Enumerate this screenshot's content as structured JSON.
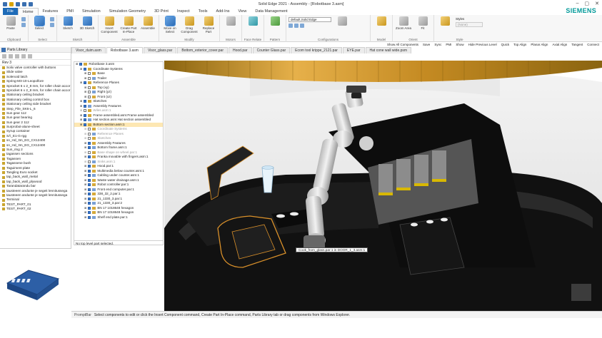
{
  "app": {
    "title": "Solid Edge 2021 - Assembly - [Robotbase 3.asm]",
    "brand": "SIEMENS",
    "window_controls": [
      "–",
      "▢",
      "✕"
    ]
  },
  "menu": {
    "file": "File",
    "tabs": [
      "Home",
      "Features",
      "PMI",
      "Simulation",
      "Simulation Geometry",
      "3D Print",
      "Inspect",
      "Tools",
      "Add-Ins",
      "View",
      "Data Management"
    ],
    "active": "Home"
  },
  "ribbon": {
    "groups": [
      {
        "label": "Clipboard",
        "buttons": [
          "Paste"
        ],
        "small": [
          "Cut",
          "Copy"
        ]
      },
      {
        "label": "Select",
        "buttons": [
          "Select"
        ],
        "small": [
          "",
          ""
        ]
      },
      {
        "label": "Sketch",
        "buttons": [
          "Sketch",
          "3D Sketch"
        ]
      },
      {
        "label": "Assemble",
        "buttons": [
          "Insert Component",
          "Create Part In-Place",
          "Assemble"
        ]
      },
      {
        "label": "Modify",
        "buttons": [
          "Move on Select",
          "Drag Component",
          "Replace Part"
        ]
      },
      {
        "label": "Motors",
        "buttons": [
          ""
        ]
      },
      {
        "label": "Face Relate",
        "buttons": [
          ""
        ]
      },
      {
        "label": "Pattern",
        "buttons": [
          ""
        ]
      },
      {
        "label": "Configurations",
        "select": "default,Solid Edge",
        "buttons": [
          ""
        ]
      },
      {
        "label": "Model",
        "buttons": [
          ""
        ]
      },
      {
        "label": "Orient",
        "buttons": [
          "Zoom Area",
          "Fit"
        ]
      },
      {
        "label": "Style",
        "buttons": [
          ""
        ],
        "select_label": "Styles",
        "select_value": "(None)"
      }
    ]
  },
  "command_bar": {
    "items": [
      "Show All Components",
      "Save",
      "Sync",
      "PMI",
      "Show",
      "Hide Previous Level",
      "Quick",
      "Top Align",
      "Planar Align",
      "Axial Align",
      "Tangent",
      "Connect"
    ]
  },
  "doc_tabs": [
    "Visor_duim.asm",
    "Robotbase 3.asm",
    "Visor_glass.par",
    "Bottom_exterior_cover.par",
    "Hood.par",
    "Counter Glass.par",
    "Ecom tool krippe_2121.par",
    "EYE.par",
    "Hat cone wall wide.psm"
  ],
  "doc_tab_active": "Robotbase 3.asm",
  "parts_library": {
    "title": "Parts Library",
    "folder": "Rev 3",
    "items": [
      "Solix valve controller with buttons",
      "Slide valve",
      "Solenoid latch",
      "Spring-M3-10-Leopolfore",
      "Sprocket 6 x 2_8 mm, for roller chain accor",
      "Sprocket 6 x 2_8 mm, for roller chain accor",
      "Stationary ceiling bracket",
      "Stationary ceiling control box",
      "Stationary ceiling side bracket",
      "Step_File_SK6-L_6",
      "Sun gear 112",
      "Sun gear bearing",
      "Sun gear 2 112",
      "Surprobot-alune-sheet",
      "Syrup container",
      "SÄ_E1-G-rgg",
      "sn_Hd_3m_EG_CX12400",
      "sn_Hd_3m_EG_CX12400",
      "Sun_ring 2",
      "tagassen sections",
      "Tagassen",
      "Tagassene bush",
      "Taguiment plate",
      "Tangling Euro socket",
      "tap_back_wall_metal",
      "tap_back_wall_plywood",
      "Tarandatarandu bar",
      "tausteeen andunte je segeit lennitussega",
      "tausteeen andunte je segeit lennitussega",
      "Terminal",
      "TEST_PART_01",
      "TEST_PART_02"
    ]
  },
  "tree": {
    "rows": [
      {
        "label": "Robotbase 3.asm",
        "indent": 0,
        "cb": true,
        "hl": false,
        "grey": false
      },
      {
        "label": "Coordinate Systems",
        "indent": 1,
        "cb": true,
        "hl": false,
        "grey": false
      },
      {
        "label": "Base",
        "indent": 2,
        "cb": false,
        "hl": false,
        "grey": false
      },
      {
        "label": "Trailer",
        "indent": 2,
        "cb": false,
        "hl": false,
        "grey": false
      },
      {
        "label": "Reference Planes",
        "indent": 1,
        "cb": true,
        "hl": false,
        "grey": false
      },
      {
        "label": "Top (xy)",
        "indent": 2,
        "cb": false,
        "hl": false,
        "grey": false
      },
      {
        "label": "Right (yz)",
        "indent": 2,
        "cb": false,
        "hl": false,
        "grey": false
      },
      {
        "label": "Front (xz)",
        "indent": 2,
        "cb": false,
        "hl": false,
        "grey": false
      },
      {
        "label": "Sketches",
        "indent": 1,
        "cb": true,
        "hl": false,
        "grey": false
      },
      {
        "label": "Assembly Features",
        "indent": 1,
        "cb": true,
        "hl": false,
        "grey": false
      },
      {
        "label": "Wiles.asm:1",
        "indent": 1,
        "cb": false,
        "hl": false,
        "grey": true
      },
      {
        "label": "Frame assembled.asm:Frame assembled",
        "indent": 1,
        "cb": true,
        "hl": false,
        "grey": false
      },
      {
        "label": "Hat section.asm:Hat section assembled",
        "indent": 1,
        "cb": true,
        "hl": false,
        "grey": false
      },
      {
        "label": "Bottom section.asm:1",
        "indent": 1,
        "cb": true,
        "hl": true,
        "grey": false
      },
      {
        "label": "Coordinate Systems",
        "indent": 2,
        "cb": false,
        "hl": false,
        "grey": true
      },
      {
        "label": "Reference Planes",
        "indent": 2,
        "cb": false,
        "hl": false,
        "grey": true
      },
      {
        "label": "Sketches",
        "indent": 2,
        "cb": false,
        "hl": false,
        "grey": true
      },
      {
        "label": "Assembly Features",
        "indent": 2,
        "cb": true,
        "hl": false,
        "grey": false
      },
      {
        "label": "Bottom frame.asm:1",
        "indent": 2,
        "cb": true,
        "hl": false,
        "grey": false
      },
      {
        "label": "Base shape on wheel.par:1",
        "indent": 2,
        "cb": false,
        "hl": false,
        "grey": true
      },
      {
        "label": "Franka movable with fingers.asm:1",
        "indent": 2,
        "cb": true,
        "hl": false,
        "grey": false
      },
      {
        "label": "Sinks.asm:1",
        "indent": 2,
        "cb": false,
        "hl": false,
        "grey": true
      },
      {
        "label": "Hood.par:1",
        "indent": 2,
        "cb": true,
        "hl": false,
        "grey": false
      },
      {
        "label": "Multimedia below counter.asm:1",
        "indent": 2,
        "cb": true,
        "hl": false,
        "grey": false
      },
      {
        "label": "Cabling under counter.asm:1",
        "indent": 2,
        "cb": true,
        "hl": false,
        "grey": false
      },
      {
        "label": "Waste water drainage.asm:1",
        "indent": 2,
        "cb": true,
        "hl": false,
        "grey": false
      },
      {
        "label": "Robot controller.par:1",
        "indent": 2,
        "cb": true,
        "hl": false,
        "grey": false
      },
      {
        "label": "Front end computer.par:1",
        "indent": 2,
        "cb": true,
        "hl": false,
        "grey": false
      },
      {
        "label": "338_32_2.par:1",
        "indent": 2,
        "cb": true,
        "hl": false,
        "grey": false
      },
      {
        "label": "21_1330_3.par:1",
        "indent": 2,
        "cb": true,
        "hl": false,
        "grey": false
      },
      {
        "label": "21_1330_3.par:2",
        "indent": 2,
        "cb": true,
        "hl": false,
        "grey": false
      },
      {
        "label": "BN 17 1018648 hexagon",
        "indent": 2,
        "cb": true,
        "hl": false,
        "grey": false
      },
      {
        "label": "BN 17 1018648 hexagon",
        "indent": 2,
        "cb": true,
        "hl": false,
        "grey": false
      },
      {
        "label": "Shelf end plate.par:1",
        "indent": 2,
        "cb": true,
        "hl": false,
        "grey": false
      }
    ],
    "status": "No top level part selected."
  },
  "viewport": {
    "tooltip": "Cook_from_glass.par:1 in DOOR_1_3.asm:1"
  },
  "prompt_bar": {
    "label": "PromptBar",
    "text": "Select components to edit or click the Insert Component command, Create Part In-Place command, Parts Library tab or drag components from Windows Explorer."
  },
  "colors": {
    "file_tab": "#1e6bb8",
    "siemens": "#009999",
    "highlight_row": "#fde7b3",
    "orange_accent": "#d9902a"
  }
}
